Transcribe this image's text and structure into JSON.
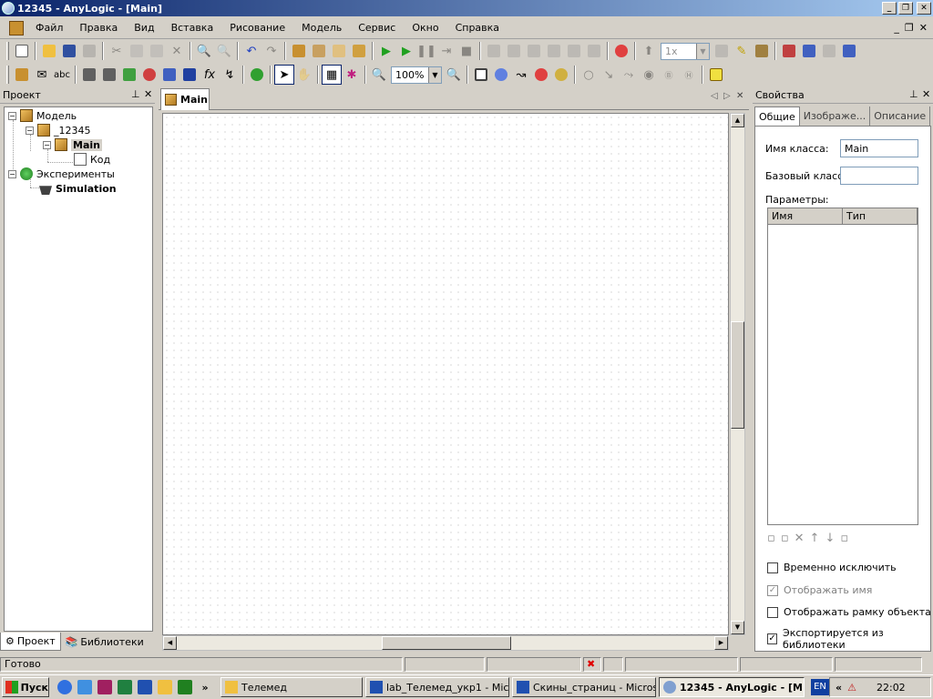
{
  "window": {
    "title": "12345 - AnyLogic - [Main]"
  },
  "menu": [
    "Файл",
    "Правка",
    "Вид",
    "Вставка",
    "Рисование",
    "Модель",
    "Сервис",
    "Окно",
    "Справка"
  ],
  "toolbar": {
    "zoom": "100%",
    "speed": "1x"
  },
  "project": {
    "title": "Проект",
    "tree": {
      "model": "Модель",
      "package": "_12345",
      "main": "Main",
      "code": "Код",
      "experiments": "Эксперименты",
      "simulation": "Simulation"
    },
    "tabs": {
      "project": "Проект",
      "libraries": "Библиотеки"
    }
  },
  "editor": {
    "tab": "Main"
  },
  "properties": {
    "title": "Свойства",
    "tabs": [
      "Общие",
      "Изображе...",
      "Описание"
    ],
    "class_name_label": "Имя класса:",
    "class_name_value": "Main",
    "base_class_label": "Базовый класс:",
    "base_class_value": "",
    "params_label": "Параметры:",
    "columns": [
      "Имя",
      "Тип"
    ],
    "checkboxes": [
      {
        "label": "Временно исключить",
        "checked": false,
        "disabled": false
      },
      {
        "label": "Отображать имя",
        "checked": true,
        "disabled": true
      },
      {
        "label": "Отображать рамку объекта",
        "checked": false,
        "disabled": false
      },
      {
        "label": "Экспортируется из библиотеки",
        "checked": true,
        "disabled": false
      }
    ]
  },
  "status": {
    "text": "Готово"
  },
  "taskbar": {
    "start": "Пуск",
    "tasks": [
      "Телемед",
      "lab_Телемед_укр1 - Mic...",
      "Скины_страниц - Micros...",
      "12345 - AnyLogic - [M..."
    ],
    "lang": "EN",
    "time": "22:02"
  }
}
